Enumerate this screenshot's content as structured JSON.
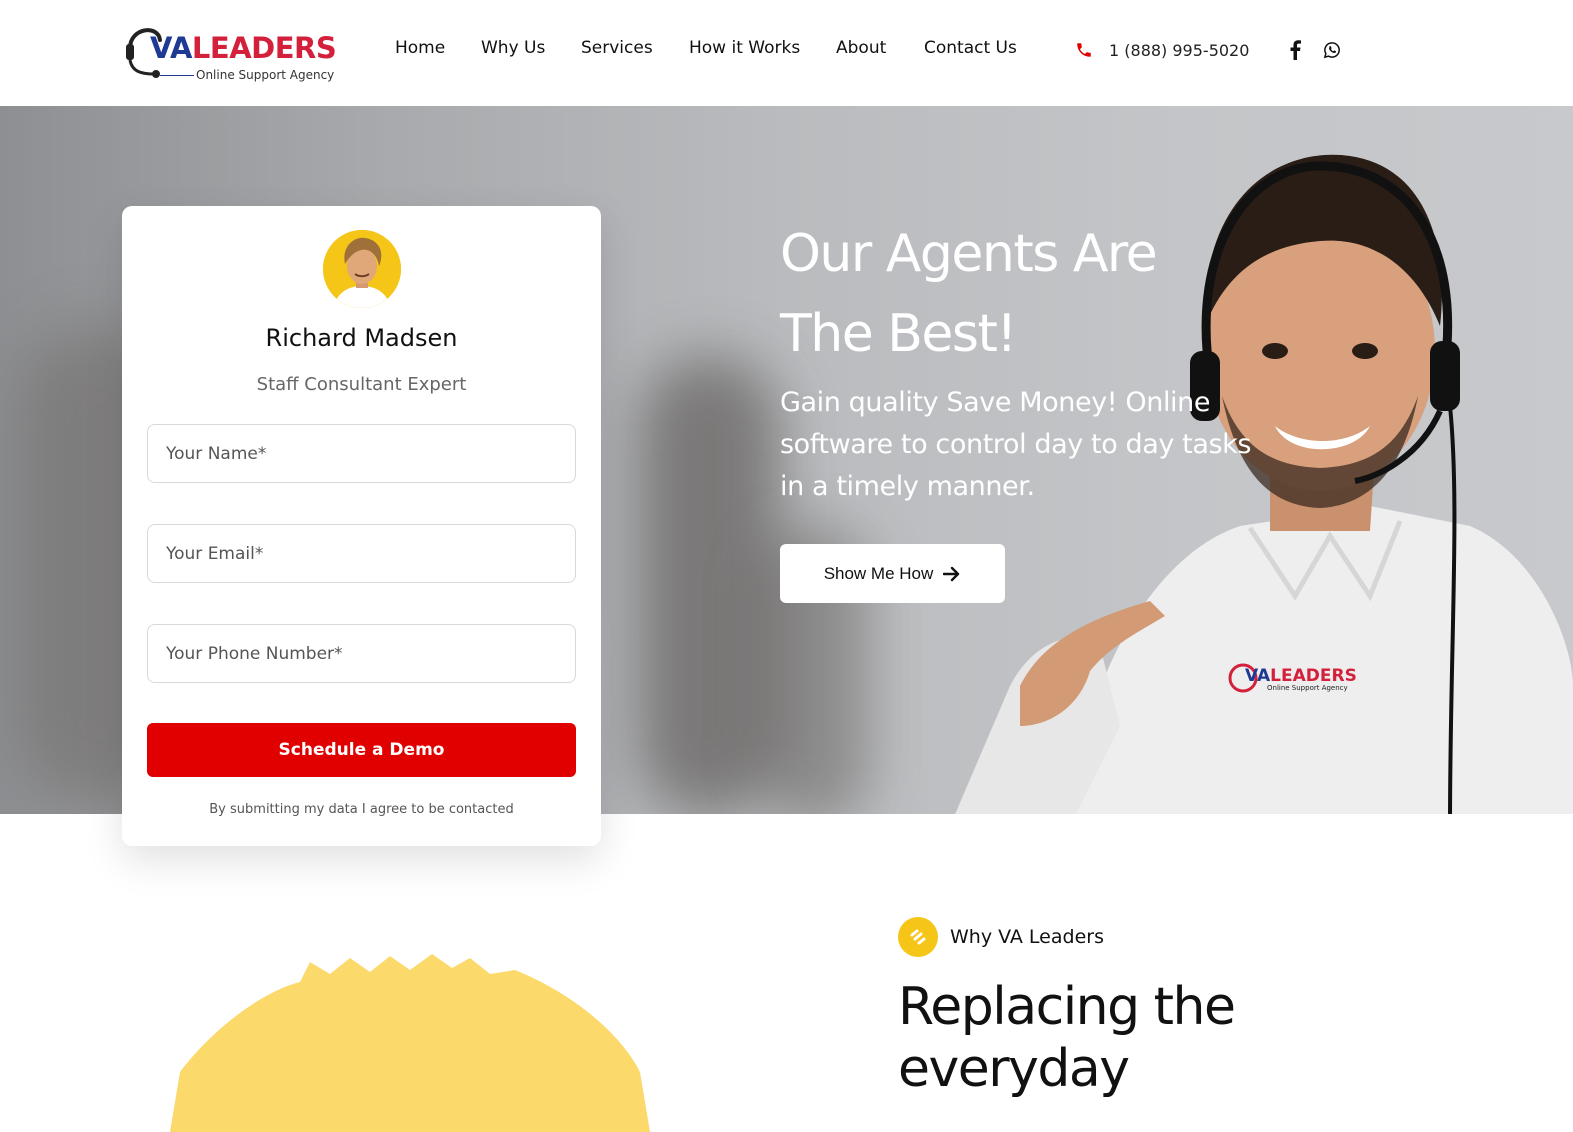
{
  "brand": {
    "name_part1": "VA",
    "name_part2": "LEADERS",
    "tagline": "Online Support Agency"
  },
  "nav": {
    "items": [
      {
        "label": "Home"
      },
      {
        "label": "Why Us"
      },
      {
        "label": "Services"
      },
      {
        "label": "How it Works"
      },
      {
        "label": "About"
      },
      {
        "label": "Contact Us"
      }
    ]
  },
  "contact": {
    "phone": "1 (888) 995-5020",
    "phone_icon": "phone-icon",
    "social": [
      "facebook-icon",
      "whatsapp-icon"
    ]
  },
  "hero": {
    "title_line1": "Our Agents Are",
    "title_line2": "The Best!",
    "subtitle": "Gain quality Save Money! Online software to control day to day tasks in a timely manner.",
    "cta_label": "Show Me How",
    "cta_icon": "arrow-right-icon",
    "shirt_logo": {
      "part1": "VA",
      "part2": "LEADERS",
      "tagline": "Online Support Agency"
    }
  },
  "form": {
    "consultant_name": "Richard Madsen",
    "consultant_role": "Staff Consultant Expert",
    "name_placeholder": "Your Name*",
    "email_placeholder": "Your Email*",
    "phone_placeholder": "Your Phone Number*",
    "submit_label": "Schedule a Demo",
    "consent": "By submitting my data I agree to be contacted"
  },
  "why": {
    "label": "Why VA Leaders",
    "title": "Replacing the everyday"
  },
  "colors": {
    "accent_red": "#e00000",
    "brand_blue": "#1f3a93",
    "brand_red": "#d4213b",
    "yellow": "#f5c518"
  }
}
